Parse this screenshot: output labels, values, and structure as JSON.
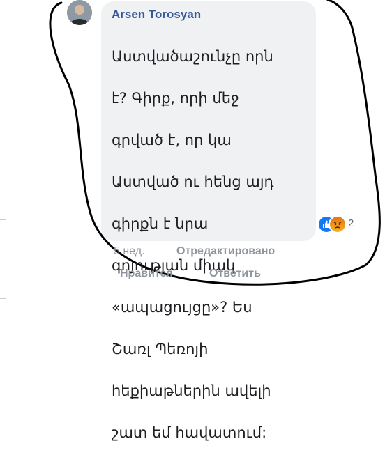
{
  "comment": {
    "author": "Arsen Torosyan",
    "text_lines": [
      "Աստվածաշունչը որն",
      "է? Գիրք, որի մեջ",
      "գրված է, որ կա",
      "Աստված ու հենց այդ",
      "գիրքն է նրա",
      "գոյության միակ",
      "«ապացույցը»? Ես",
      "Շառլ Պեռոյի",
      "հեքիաթներին ավելի",
      "շատ եմ հավատում:"
    ],
    "reactions": {
      "icons": [
        "like-icon",
        "angry-icon"
      ],
      "count": "2"
    },
    "timestamp": "5 нед.",
    "edited_label": "Отредактировано",
    "actions": {
      "like": "Нравится",
      "reply": "Ответить"
    }
  },
  "colors": {
    "author": "#385898",
    "bubble": "#eff1f3",
    "meta": "#90949c",
    "like": "#1877f2",
    "angry": "#e9710f",
    "annotation_ring": "#000000"
  }
}
